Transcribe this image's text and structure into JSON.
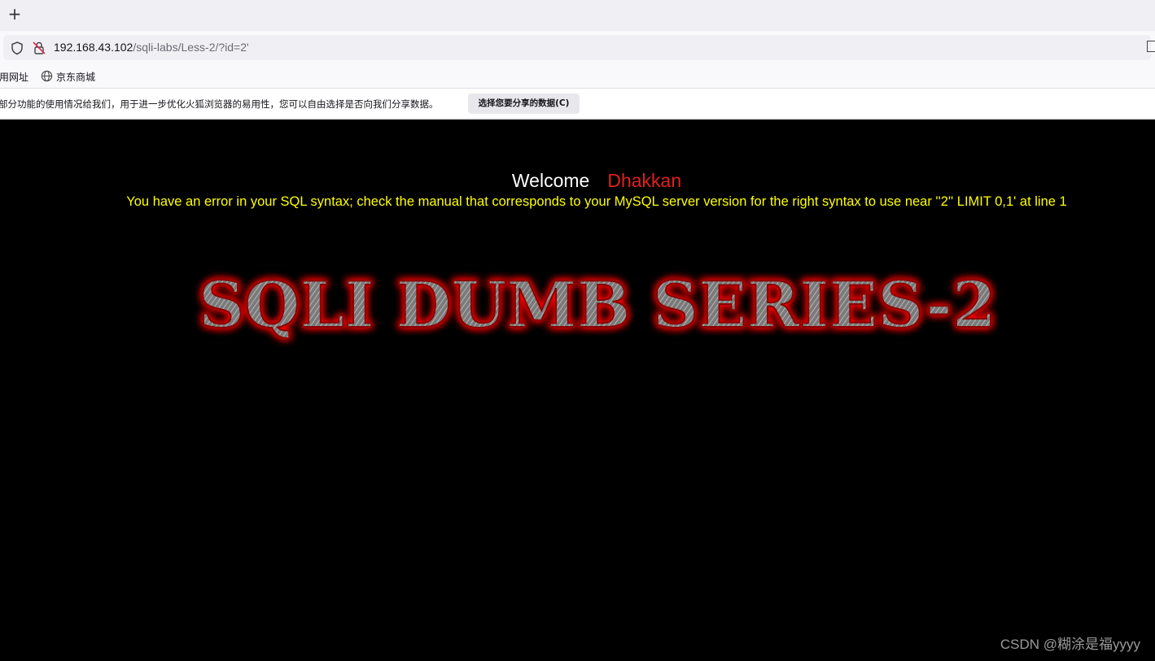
{
  "browser": {
    "new_tab_label": "+",
    "url": {
      "host": "192.168.43.102",
      "path": "/sqli-labs/Less-2/?id=2'"
    },
    "bookmarks": [
      {
        "label": "用网址"
      },
      {
        "label": "京东商城"
      }
    ],
    "notification": {
      "message": "部分功能的使用情况给我们，用于进一步优化火狐浏览器的易用性，您可以自由选择是否向我们分享数据。",
      "button_label": "选择您要分享的数据(C)"
    }
  },
  "page": {
    "welcome_label": "Welcome",
    "user_name": "Dhakkan",
    "error_message": "You have an error in your SQL syntax; check the manual that corresponds to your MySQL server version for the right syntax to use near ''2'' LIMIT 0,1' at line 1",
    "banner_text": "SQLI DUMB SERIES-2",
    "colors": {
      "background": "#000000",
      "welcome": "#ffffff",
      "user_name": "#e0201c",
      "error": "#ffff00",
      "banner_glow": "#ff0000"
    }
  },
  "watermark": "CSDN @糊涂是福yyyy"
}
